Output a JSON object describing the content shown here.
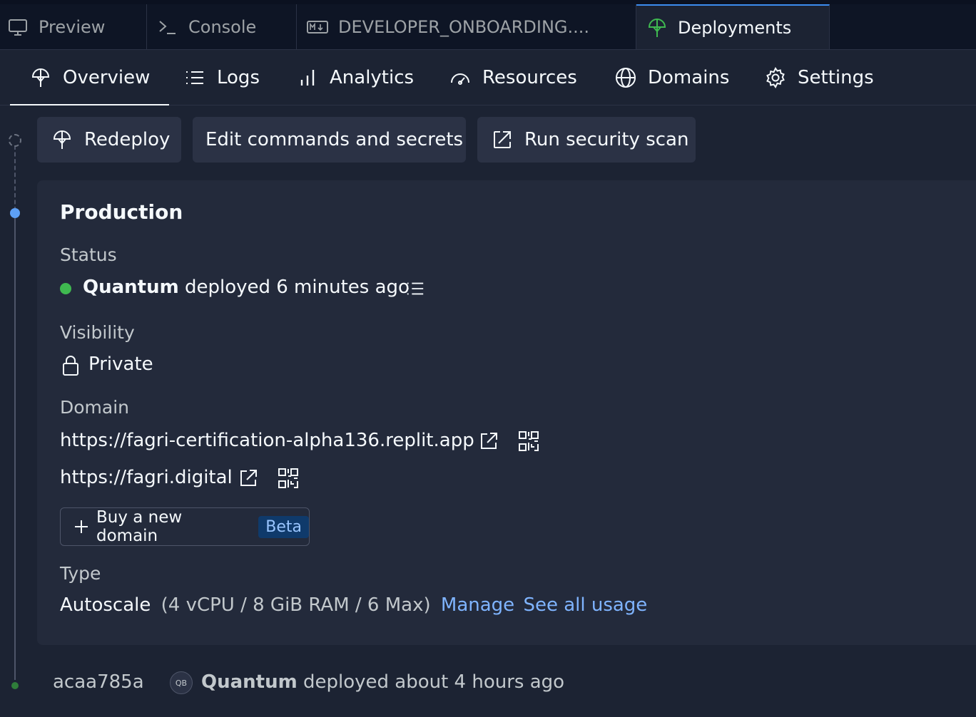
{
  "tabs": [
    {
      "label": "Preview",
      "icon": "monitor-icon"
    },
    {
      "label": "Console",
      "icon": "terminal-icon"
    },
    {
      "label": "DEVELOPER_ONBOARDING....",
      "icon": "markdown-icon"
    },
    {
      "label": "Deployments",
      "icon": "deployments-icon"
    }
  ],
  "subnav": [
    {
      "label": "Overview",
      "icon": "deployments-icon"
    },
    {
      "label": "Logs",
      "icon": "list-icon"
    },
    {
      "label": "Analytics",
      "icon": "bar-chart-icon"
    },
    {
      "label": "Resources",
      "icon": "gauge-icon"
    },
    {
      "label": "Domains",
      "icon": "globe-icon"
    },
    {
      "label": "Settings",
      "icon": "gear-icon"
    }
  ],
  "actions": {
    "redeploy": "Redeploy",
    "edit": "Edit commands and secrets",
    "scan": "Run security scan"
  },
  "production": {
    "title": "Production",
    "status_label": "Status",
    "status_user": "Quantum",
    "status_text": "deployed 6 minutes ago",
    "status_color": "#3fb950",
    "visibility_label": "Visibility",
    "visibility_value": "Private",
    "domain_label": "Domain",
    "domains": [
      "https://fagri-certification-alpha136.replit.app",
      "https://fagri.digital"
    ],
    "buy_domain": "Buy a new domain",
    "beta": "Beta",
    "type_label": "Type",
    "type_value": "Autoscale",
    "type_details": "(4 vCPU / 8 GiB RAM / 6 Max)",
    "manage": "Manage",
    "see_usage": "See all usage"
  },
  "previous": {
    "commit": "acaa785a",
    "avatar": "QB",
    "user": "Quantum",
    "text": "deployed about 4 hours ago"
  },
  "colors": {
    "accent": "#3c8cf0",
    "link": "#7fb4ff",
    "background": "#1c2333",
    "card": "#232a3b"
  }
}
